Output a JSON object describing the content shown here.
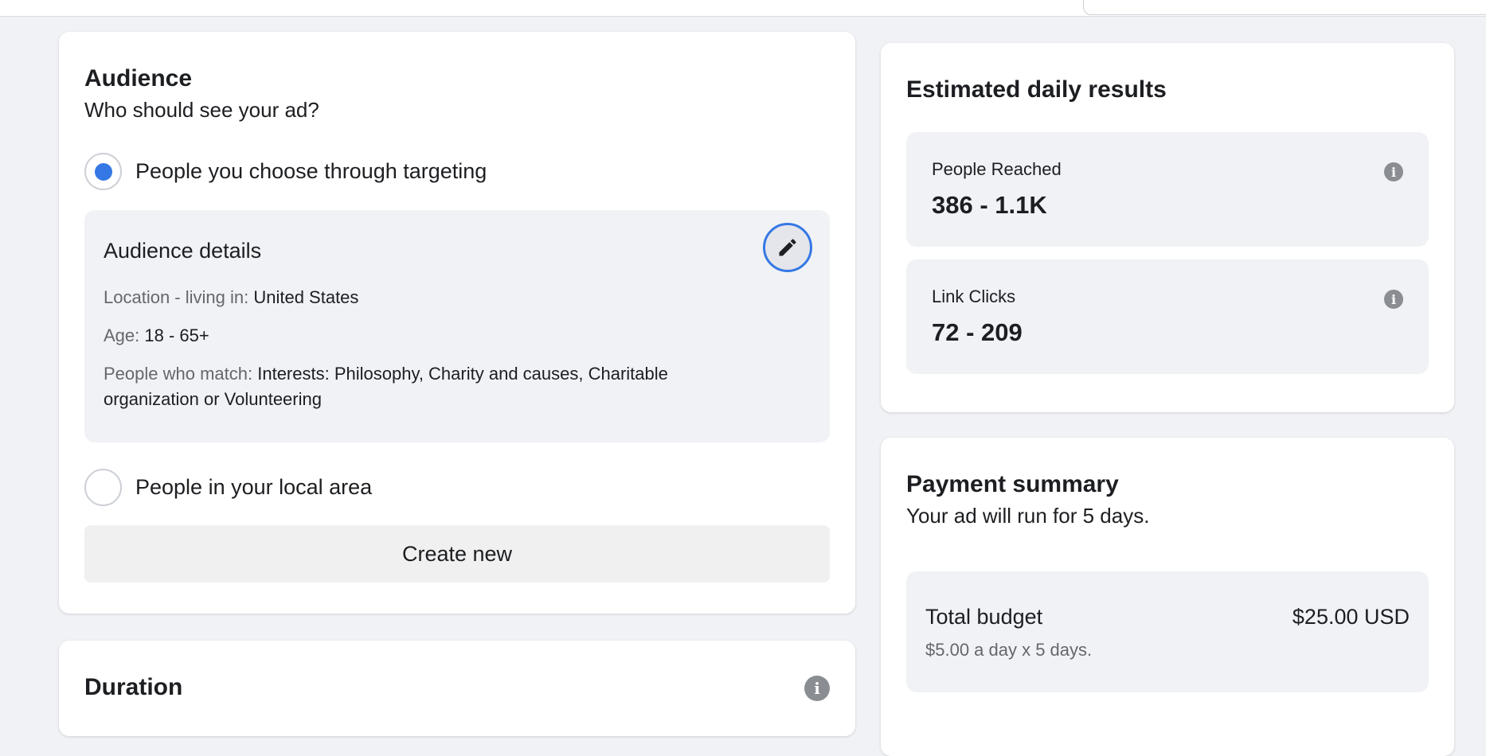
{
  "audience": {
    "title": "Audience",
    "subtitle": "Who should see your ad?",
    "option_targeting": "People you choose through targeting",
    "option_targeting_selected": true,
    "details": {
      "title": "Audience details",
      "location_label": "Location - living in:",
      "location_value": "United States",
      "age_label": "Age:",
      "age_value": "18 - 65+",
      "match_label": "People who match:",
      "match_value_line1": "Interests: Philosophy, Charity and causes, Charitable",
      "match_value_line2": "organization or Volunteering"
    },
    "option_local": "People in your local area",
    "option_local_selected": false,
    "create_new": "Create new"
  },
  "duration": {
    "title": "Duration"
  },
  "estimated": {
    "title": "Estimated daily results",
    "stats": [
      {
        "label": "People Reached",
        "value": "386 - 1.1K"
      },
      {
        "label": "Link Clicks",
        "value": "72 - 209"
      }
    ]
  },
  "payment": {
    "title": "Payment summary",
    "subtitle": "Your ad will run for 5 days.",
    "budget_label": "Total budget",
    "budget_amount": "$25.00 USD",
    "budget_detail": "$5.00 a day x 5 days."
  },
  "icons": {
    "info": "info-icon",
    "edit": "pencil-icon"
  },
  "colors": {
    "accent": "#3578e5",
    "background": "#f0f2f5"
  }
}
